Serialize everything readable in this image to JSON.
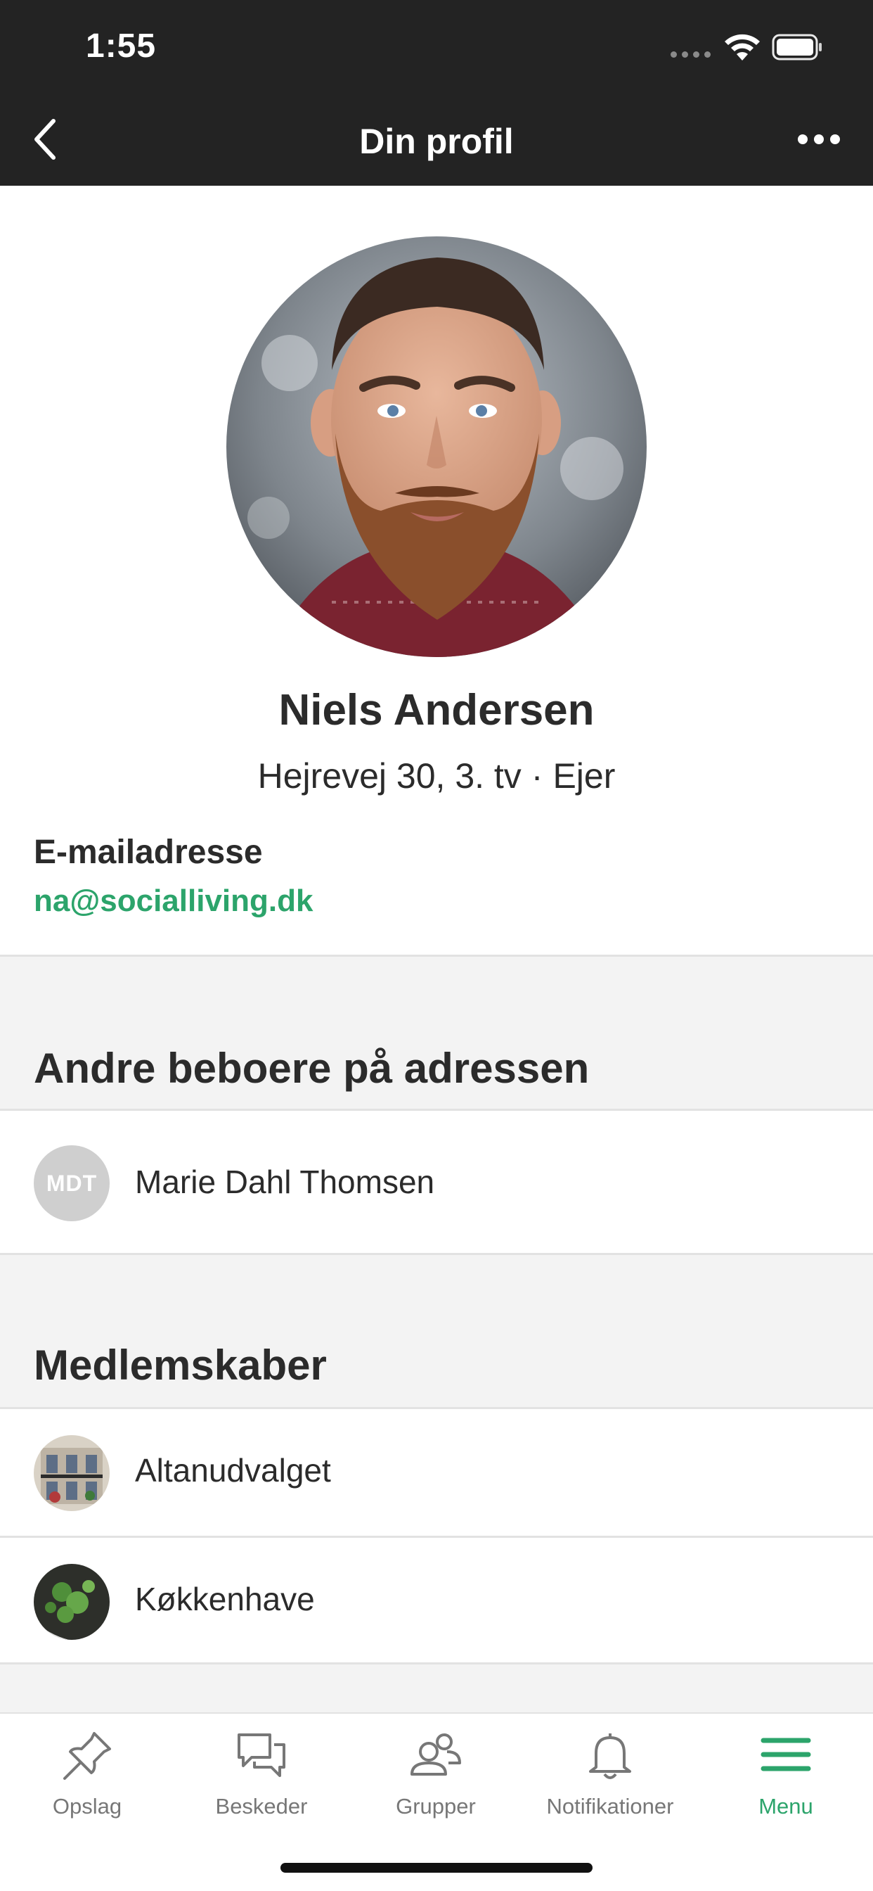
{
  "status_bar": {
    "time": "1:55",
    "icons": [
      "signal-icon",
      "wifi-icon",
      "battery-icon"
    ]
  },
  "nav": {
    "title": "Din profil",
    "back_icon": "chevron-left-icon",
    "more_icon": "more-horizontal-icon"
  },
  "profile": {
    "name": "Niels Andersen",
    "address": "Hejrevej 30, 3. tv",
    "separator": "·",
    "role": "Ejer",
    "email_label": "E-mailadresse",
    "email": "na@socialliving.dk"
  },
  "residents": {
    "title": "Andre beboere på adressen",
    "items": [
      {
        "initials": "MDT",
        "name": "Marie Dahl Thomsen"
      }
    ]
  },
  "memberships": {
    "title": "Medlemskaber",
    "items": [
      {
        "name": "Altanudvalget"
      },
      {
        "name": "Køkkenhave"
      }
    ]
  },
  "tabs": [
    {
      "label": "Opslag",
      "icon": "pin-icon",
      "active": false
    },
    {
      "label": "Beskeder",
      "icon": "chat-icon",
      "active": false
    },
    {
      "label": "Grupper",
      "icon": "people-icon",
      "active": false
    },
    {
      "label": "Notifikationer",
      "icon": "bell-icon",
      "active": false
    },
    {
      "label": "Menu",
      "icon": "menu-icon",
      "active": true
    }
  ],
  "colors": {
    "header_bg": "#232323",
    "accent": "#2ca46b",
    "section_bg": "#f3f3f3",
    "divider": "#e2e2e2"
  }
}
